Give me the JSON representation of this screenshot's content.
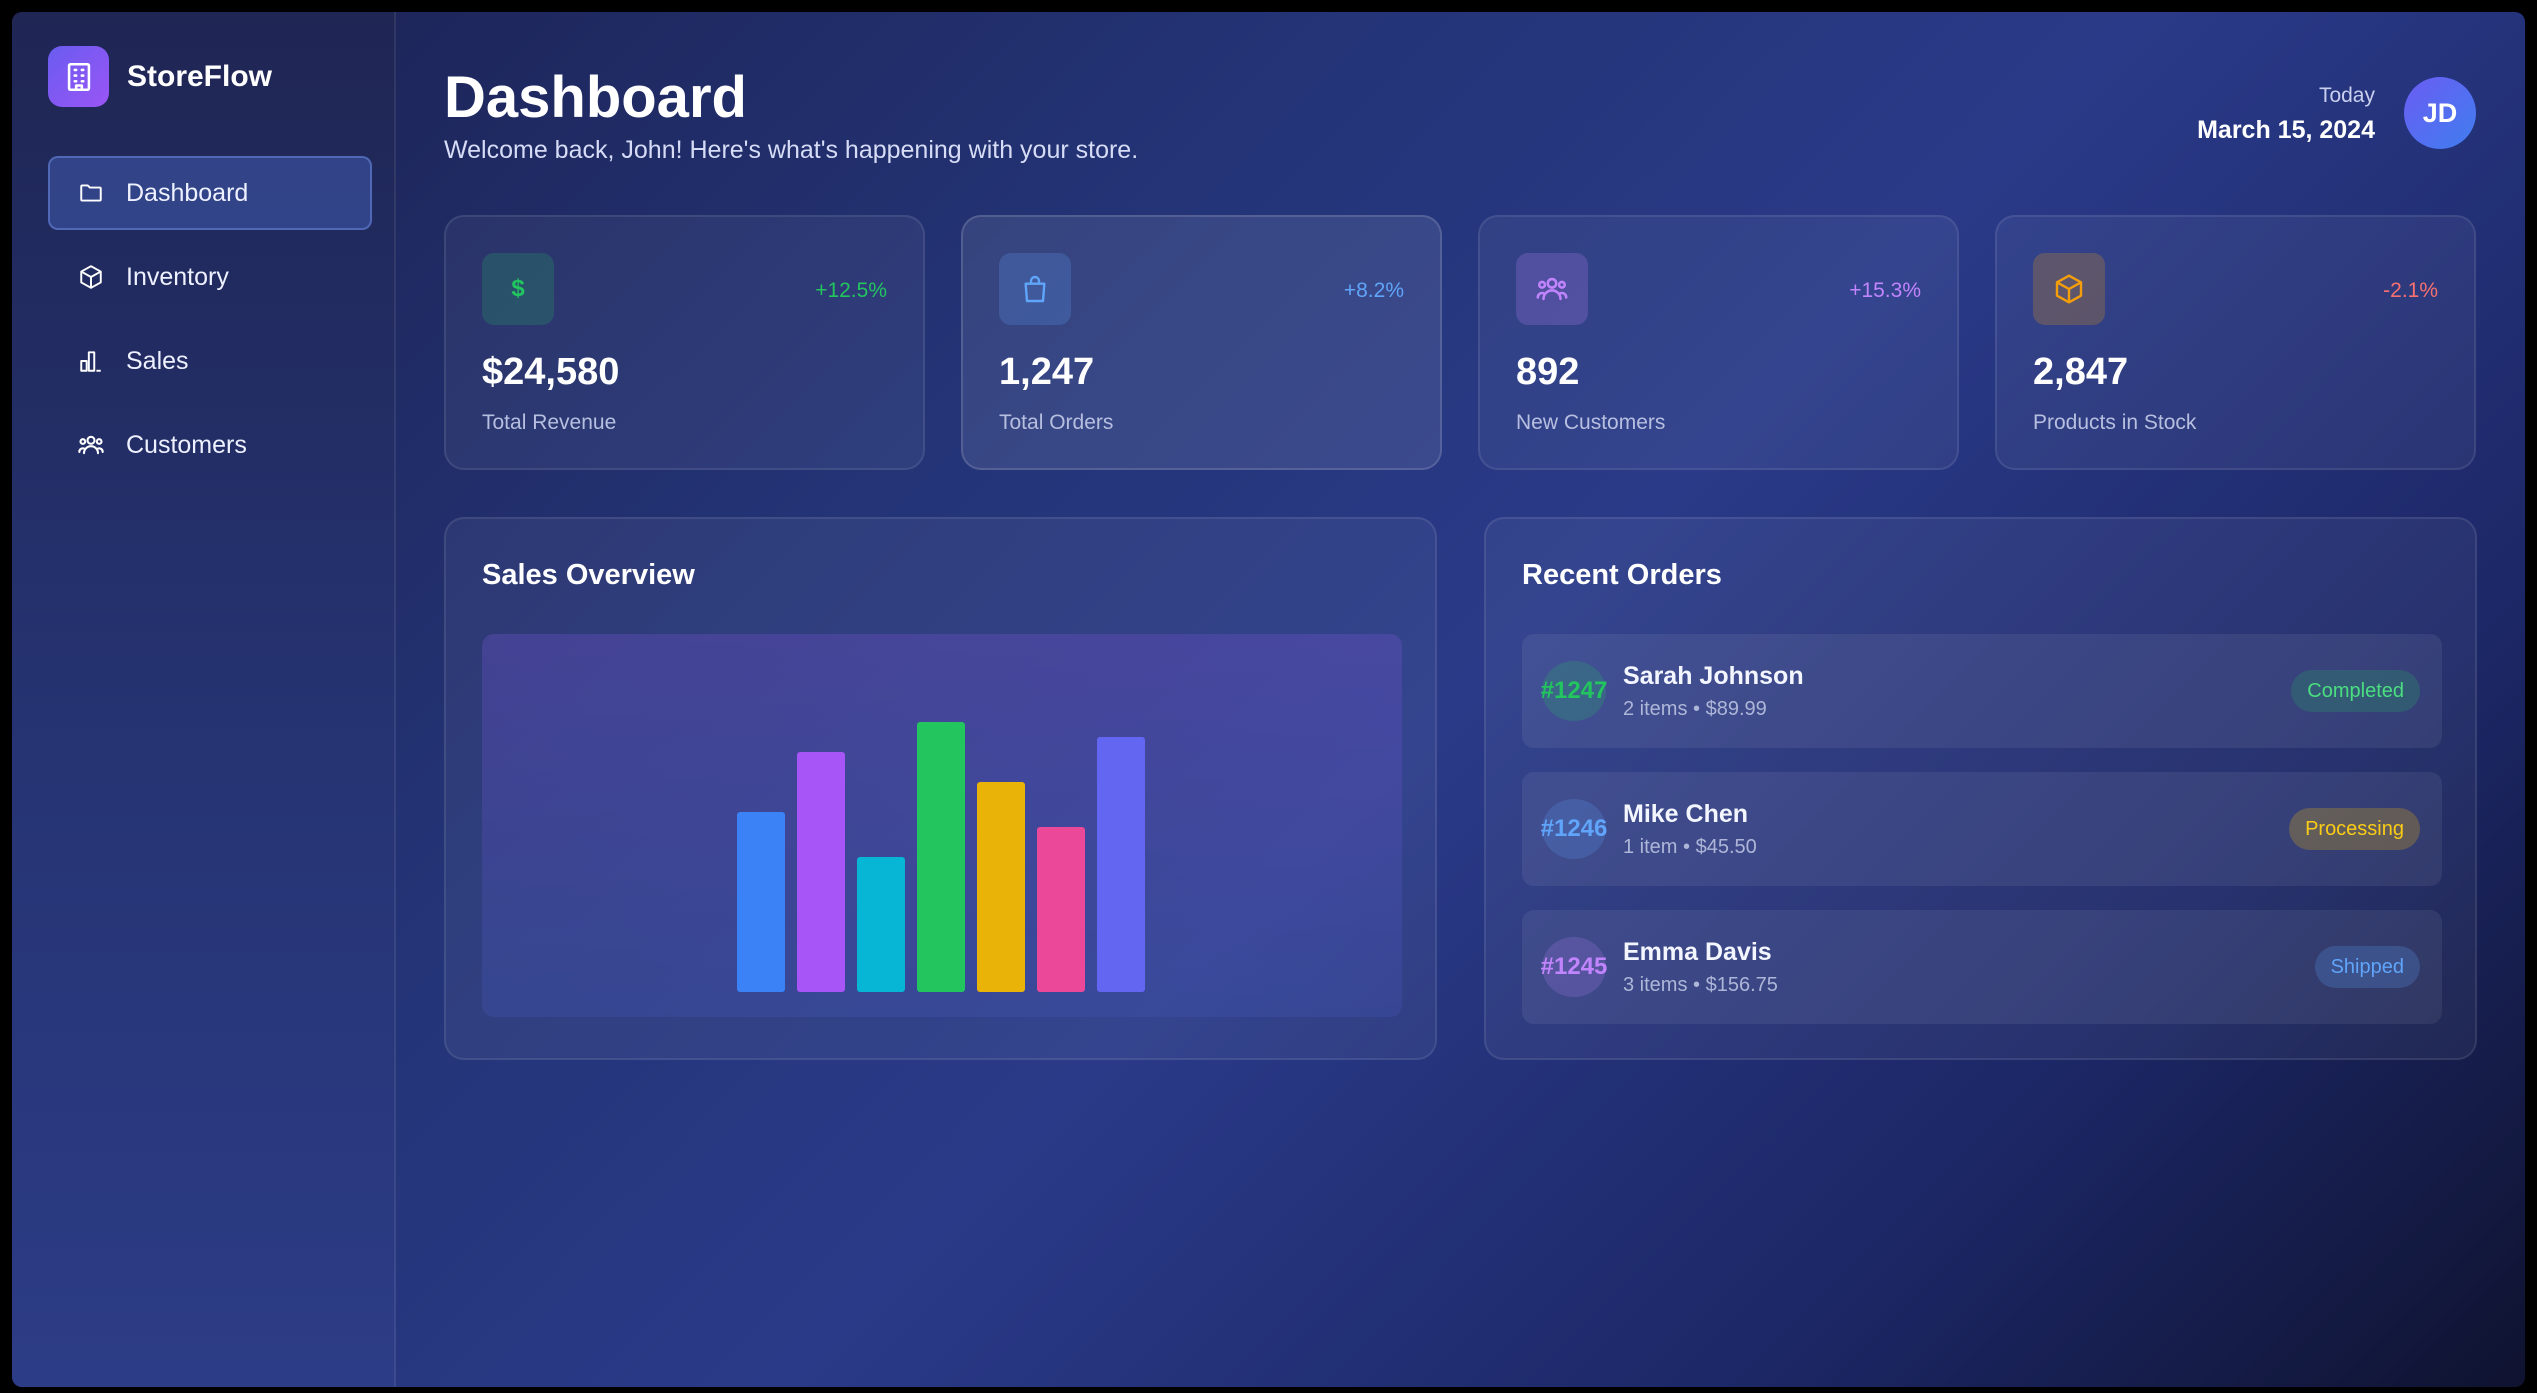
{
  "app": {
    "name": "StoreFlow",
    "logo_icon": "building-icon"
  },
  "sidebar": {
    "items": [
      {
        "label": "Dashboard",
        "icon": "folder-icon",
        "active": true
      },
      {
        "label": "Inventory",
        "icon": "box-icon",
        "active": false
      },
      {
        "label": "Sales",
        "icon": "bar-chart-icon",
        "active": false
      },
      {
        "label": "Customers",
        "icon": "users-icon",
        "active": false
      }
    ]
  },
  "header": {
    "title": "Dashboard",
    "subtitle": "Welcome back, John! Here's what's happening with your store.",
    "date_label": "Today",
    "date_value": "March 15, 2024",
    "avatar_initials": "JD"
  },
  "stats": [
    {
      "value": "$24,580",
      "label": "Total Revenue",
      "change": "+12.5%",
      "icon": "dollar-icon",
      "icon_text": "$",
      "color": "#22c55e"
    },
    {
      "value": "1,247",
      "label": "Total Orders",
      "change": "+8.2%",
      "icon": "shopping-bag-icon",
      "color": "#60a5fa"
    },
    {
      "value": "892",
      "label": "New Customers",
      "change": "+15.3%",
      "icon": "users-icon",
      "color": "#c084fc"
    },
    {
      "value": "2,847",
      "label": "Products in Stock",
      "change": "-2.1%",
      "icon": "package-icon",
      "color": "#f87171",
      "icon_color": "#f59e0b"
    }
  ],
  "sales_overview": {
    "title": "Sales Overview"
  },
  "chart_data": {
    "type": "bar",
    "title": "Sales Overview",
    "xlabel": "",
    "ylabel": "",
    "grid": false,
    "values": [
      60,
      80,
      45,
      90,
      70,
      55,
      85
    ],
    "colors": [
      "#3b82f6",
      "#a855f7",
      "#06b6d4",
      "#22c55e",
      "#eab308",
      "#ec4899",
      "#6366f1"
    ],
    "ylim": [
      0,
      100
    ]
  },
  "recent_orders": {
    "title": "Recent Orders",
    "orders": [
      {
        "id": "#1247",
        "name": "Sarah Johnson",
        "meta": "2 items • $89.99",
        "status": "Completed",
        "color": "#22c55e"
      },
      {
        "id": "#1246",
        "name": "Mike Chen",
        "meta": "1 item • $45.50",
        "status": "Processing",
        "color": "#eab308",
        "id_color": "#60a5fa"
      },
      {
        "id": "#1245",
        "name": "Emma Davis",
        "meta": "3 items • $156.75",
        "status": "Shipped",
        "color": "#60a5fa",
        "id_color": "#c084fc"
      }
    ]
  }
}
